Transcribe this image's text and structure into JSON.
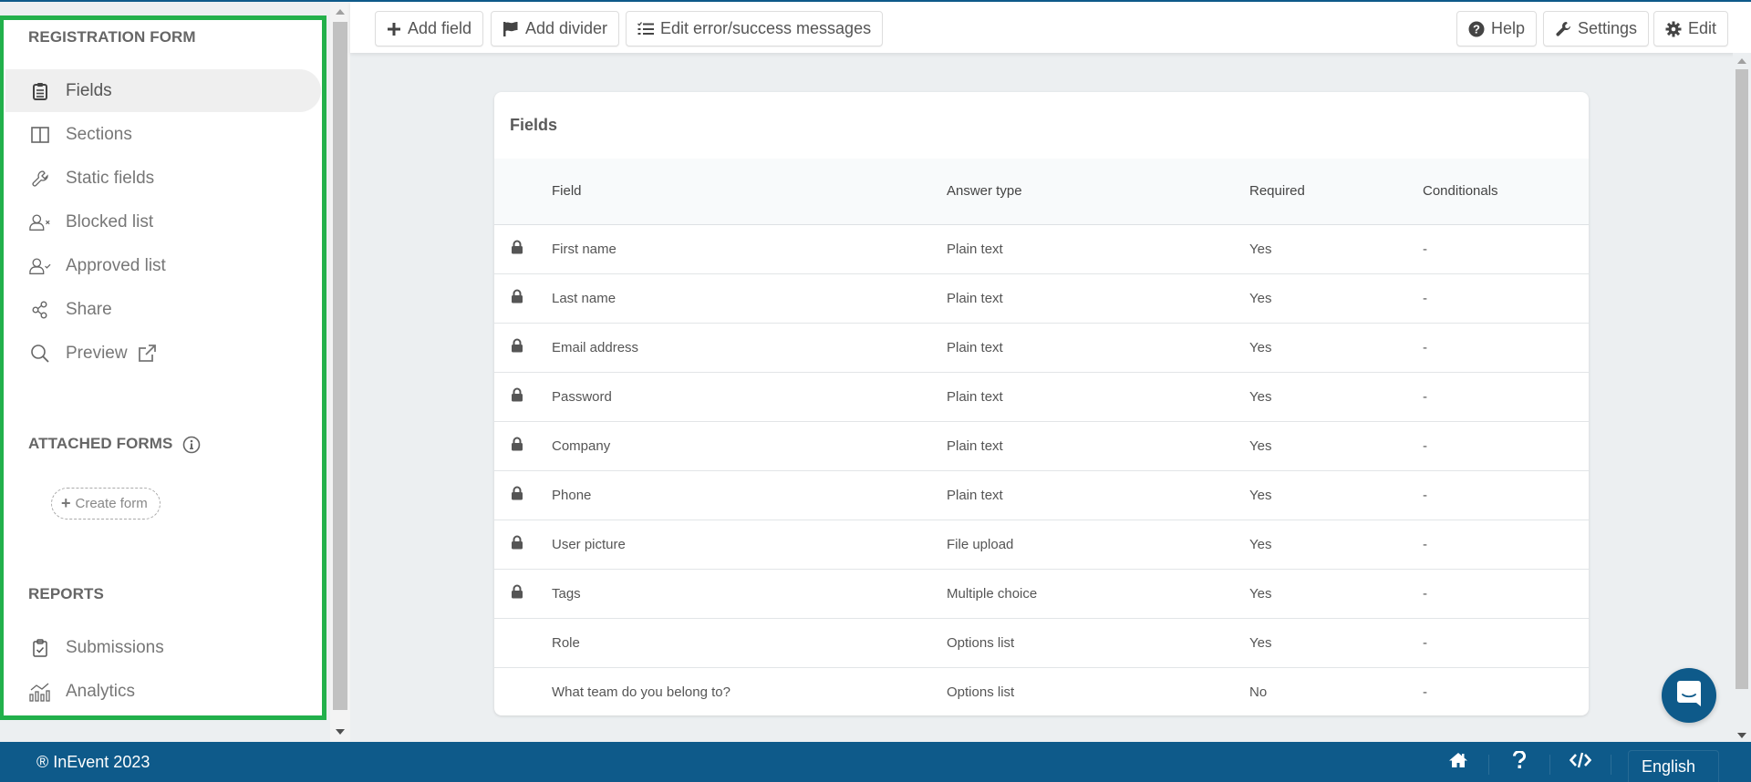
{
  "sidebar": {
    "section_registration": "REGISTRATION FORM",
    "items": [
      {
        "label": "Fields",
        "icon": "clipboard-list-icon",
        "active": true
      },
      {
        "label": "Sections",
        "icon": "columns-icon"
      },
      {
        "label": "Static fields",
        "icon": "wrench-icon"
      },
      {
        "label": "Blocked list",
        "icon": "user-x-icon"
      },
      {
        "label": "Approved list",
        "icon": "user-check-icon"
      },
      {
        "label": "Share",
        "icon": "share-icon"
      },
      {
        "label": "Preview",
        "icon": "search-icon",
        "external": true
      }
    ],
    "section_attached": "ATTACHED FORMS",
    "create_form_label": "Create form",
    "section_reports": "REPORTS",
    "reports": [
      {
        "label": "Submissions",
        "icon": "clipboard-check-icon"
      },
      {
        "label": "Analytics",
        "icon": "analytics-icon"
      }
    ]
  },
  "toolbar": {
    "add_field": "Add field",
    "add_divider": "Add divider",
    "edit_messages": "Edit error/success messages",
    "help": "Help",
    "settings": "Settings",
    "edit": "Edit"
  },
  "card": {
    "title": "Fields",
    "columns": [
      "Field",
      "Answer type",
      "Required",
      "Conditionals"
    ],
    "rows": [
      {
        "locked": true,
        "field": "First name",
        "type": "Plain text",
        "required": "Yes",
        "conditionals": "-"
      },
      {
        "locked": true,
        "field": "Last name",
        "type": "Plain text",
        "required": "Yes",
        "conditionals": "-"
      },
      {
        "locked": true,
        "field": "Email address",
        "type": "Plain text",
        "required": "Yes",
        "conditionals": "-"
      },
      {
        "locked": true,
        "field": "Password",
        "type": "Plain text",
        "required": "Yes",
        "conditionals": "-"
      },
      {
        "locked": true,
        "field": "Company",
        "type": "Plain text",
        "required": "Yes",
        "conditionals": "-"
      },
      {
        "locked": true,
        "field": "Phone",
        "type": "Plain text",
        "required": "Yes",
        "conditionals": "-"
      },
      {
        "locked": true,
        "field": "User picture",
        "type": "File upload",
        "required": "Yes",
        "conditionals": "-"
      },
      {
        "locked": true,
        "field": "Tags",
        "type": "Multiple choice",
        "required": "Yes",
        "conditionals": "-"
      },
      {
        "locked": false,
        "field": "Role",
        "type": "Options list",
        "required": "Yes",
        "conditionals": "-"
      },
      {
        "locked": false,
        "field": "What team do you belong to?",
        "type": "Options list",
        "required": "No",
        "conditionals": "-"
      }
    ]
  },
  "footer": {
    "copyright": "® InEvent 2023",
    "language": "English"
  },
  "colors": {
    "brand": "#0e5a8a",
    "highlight_border": "#22b04b",
    "background": "#eceff1"
  }
}
